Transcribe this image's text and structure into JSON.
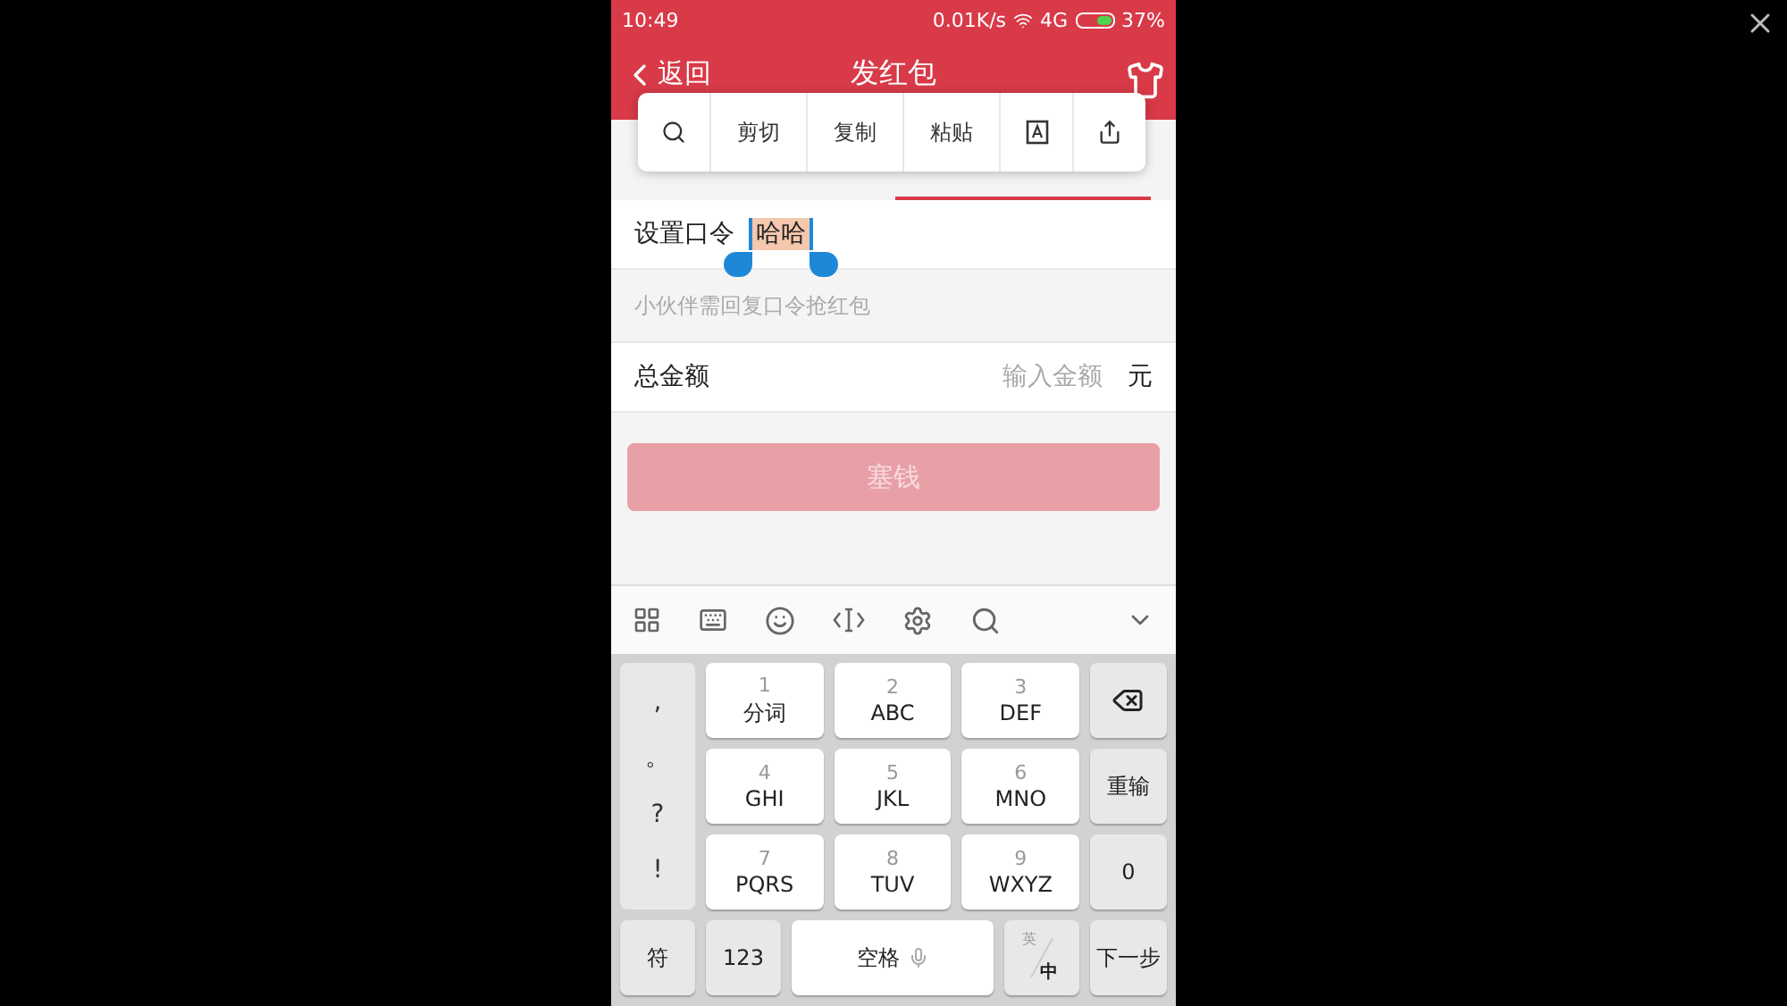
{
  "status_bar": {
    "time": "10:49",
    "speed": "0.01K/s",
    "network": "4G",
    "battery": "37%"
  },
  "header": {
    "back": "返回",
    "title": "发红包"
  },
  "context_menu": {
    "items": [
      "剪切",
      "复制",
      "粘贴"
    ]
  },
  "password_row": {
    "label": "设置口令",
    "value": "哈哈",
    "selection": true
  },
  "hint": "小伙伴需回复口令抢红包",
  "amount_row": {
    "label": "总金额",
    "placeholder": "输入金额",
    "unit": "元"
  },
  "submit": {
    "label": "塞钱",
    "disabled": true
  },
  "keyboard": {
    "symbols": [
      ",",
      "。",
      "?",
      "!"
    ],
    "keys": [
      {
        "digit": "1",
        "letters": "分词"
      },
      {
        "digit": "2",
        "letters": "ABC"
      },
      {
        "digit": "3",
        "letters": "DEF"
      },
      {
        "digit": "4",
        "letters": "GHI"
      },
      {
        "digit": "5",
        "letters": "JKL"
      },
      {
        "digit": "6",
        "letters": "MNO"
      },
      {
        "digit": "7",
        "letters": "PQRS"
      },
      {
        "digit": "8",
        "letters": "TUV"
      },
      {
        "digit": "9",
        "letters": "WXYZ"
      }
    ],
    "retype": "重输",
    "zero": "0",
    "symbol_key": "符",
    "number_key": "123",
    "space": "空格",
    "lang_top": "英",
    "lang_bottom": "中",
    "next": "下一步"
  }
}
